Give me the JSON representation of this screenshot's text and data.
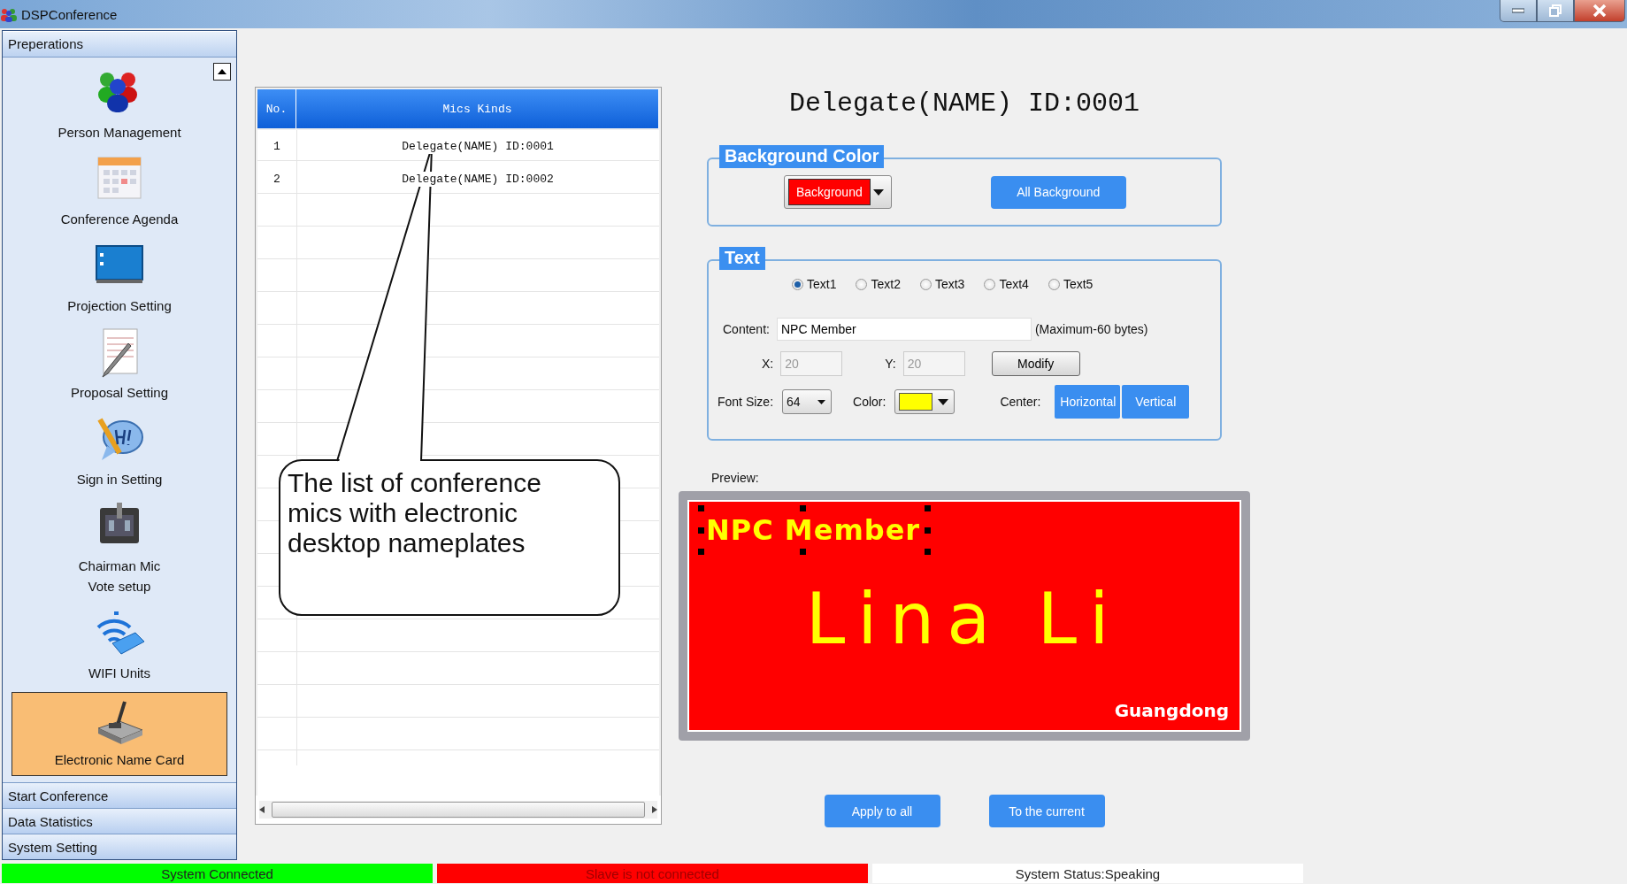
{
  "window": {
    "title": "DSPConference"
  },
  "sidebar": {
    "header": "Preperations",
    "items": [
      {
        "label": "Person Management",
        "kind": "people",
        "selected": false
      },
      {
        "label": "Conference Agenda",
        "kind": "calendar",
        "selected": false
      },
      {
        "label": "Projection Setting",
        "kind": "projection",
        "selected": false
      },
      {
        "label": "Proposal Setting",
        "kind": "proposal",
        "selected": false
      },
      {
        "label": "Sign in Setting",
        "kind": "signin",
        "selected": false
      },
      {
        "label": "Chairman Mic\nVote setup",
        "kind": "chairman",
        "selected": false
      },
      {
        "label": "WIFI Units",
        "kind": "wifi",
        "selected": false
      },
      {
        "label": "Electronic Name Card",
        "kind": "namecard",
        "selected": true
      }
    ],
    "sections": [
      "Start Conference",
      "Data Statistics",
      "System Setting"
    ]
  },
  "mic_list": {
    "columns": [
      "No.",
      "Mics Kinds"
    ],
    "rows": [
      [
        "1",
        "Delegate(NAME) ID:0001"
      ],
      [
        "2",
        "Delegate(NAME) ID:0002"
      ]
    ]
  },
  "callout": {
    "text": "The list of conference mics with electronic desktop nameplates"
  },
  "editor": {
    "title": "Delegate(NAME) ID:0001",
    "background_group": {
      "legend": "Background Color",
      "dropdown": {
        "value": "Background",
        "color": "#ff0000"
      },
      "button": "All Background"
    },
    "text_group": {
      "legend": "Text",
      "radios": [
        {
          "label": "Text1",
          "selected": true
        },
        {
          "label": "Text2",
          "selected": false
        },
        {
          "label": "Text3",
          "selected": false
        },
        {
          "label": "Text4",
          "selected": false
        },
        {
          "label": "Text5",
          "selected": false
        }
      ],
      "content_label": "Content:",
      "content_value": "NPC Member",
      "content_hint": "(Maximum-60 bytes)",
      "x_label": "X:",
      "x_field": {
        "value": "20",
        "disabled": true
      },
      "y_label": "Y:",
      "y_field": {
        "value": "20",
        "disabled": true
      },
      "modify": "Modify",
      "font_size_label": "Font Size:",
      "font_size": "64",
      "color_label": "Color:",
      "color": "#ffff00",
      "center_label": "Center:",
      "center_buttons": [
        "Horizontal",
        "Vertical"
      ]
    },
    "preview": {
      "label": "Preview:",
      "color": "#ff0000",
      "lines": [
        {
          "text": "NPC Member",
          "kind": "top-left",
          "color": "#ffff00",
          "selected": true
        },
        {
          "text": "Lina Li",
          "kind": "center",
          "color": "#ffff00",
          "selected": false
        },
        {
          "text": "Guangdong",
          "kind": "bottom-right",
          "color": "#ffffff",
          "selected": false
        }
      ]
    },
    "buttons": [
      "Apply to all",
      "To the current"
    ]
  },
  "status_bar": [
    {
      "text": "System Connected",
      "color": "#00ff00"
    },
    {
      "text": "Slave is not connected",
      "color": "#ff0000"
    },
    {
      "text": "System Status:Speaking",
      "color": "#ffffff"
    }
  ]
}
